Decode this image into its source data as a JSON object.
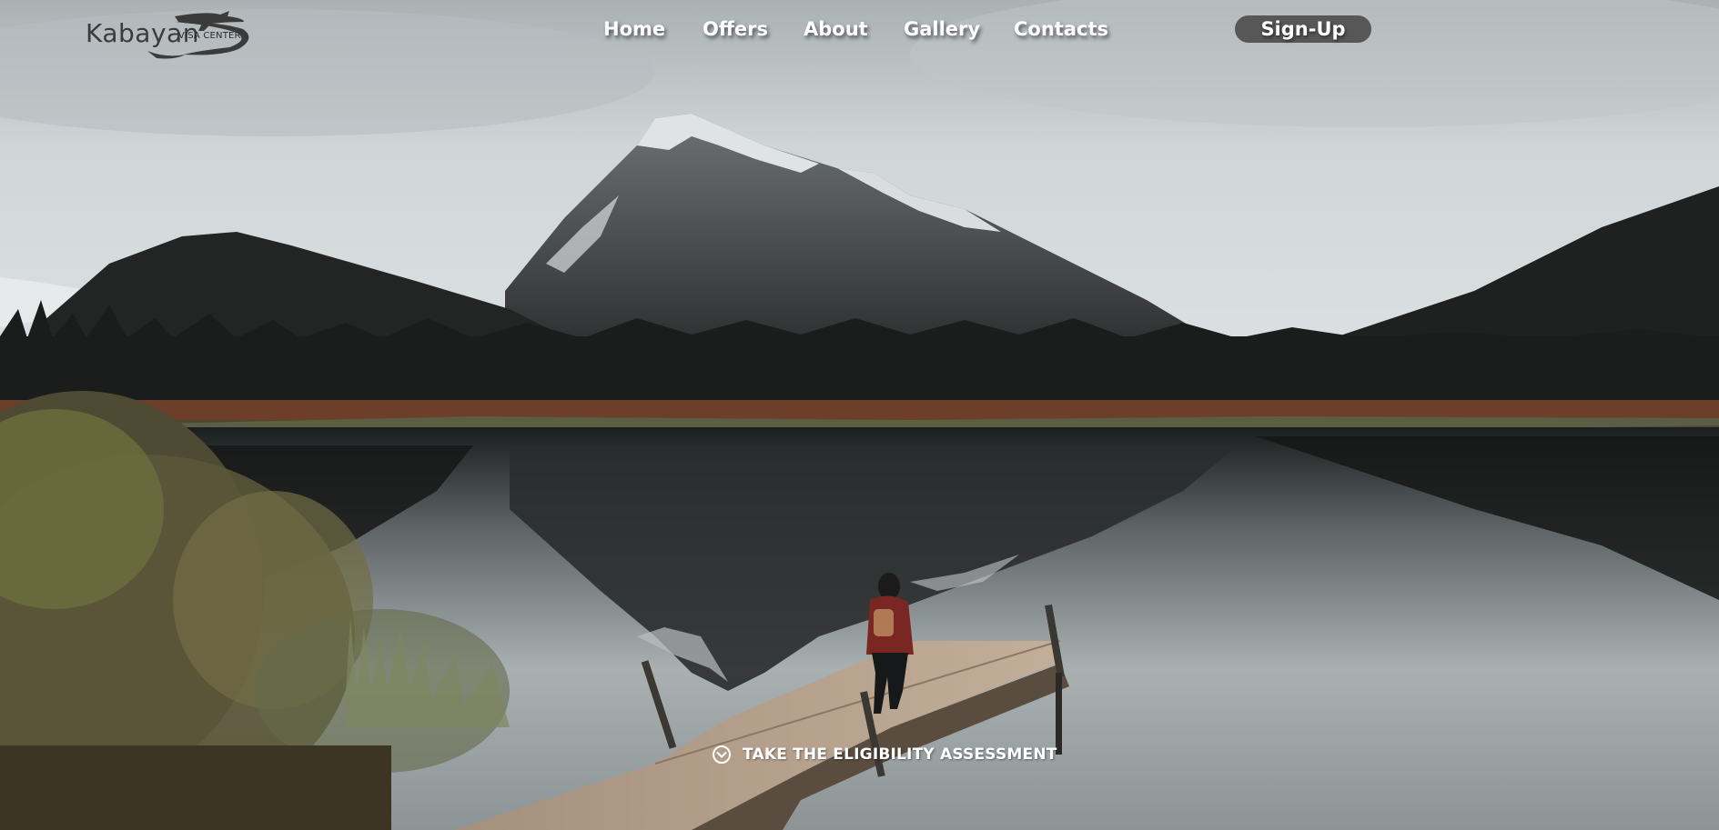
{
  "brand": {
    "name": "Kabayan",
    "subtitle": "VISA CENTER",
    "logo_color": "#3b3b3b"
  },
  "nav": {
    "items": [
      {
        "label": "Home"
      },
      {
        "label": "Offers"
      },
      {
        "label": "About"
      },
      {
        "label": "Gallery"
      },
      {
        "label": "Contacts"
      }
    ],
    "signup_label": "Sign-Up",
    "signup_bg": "#575757"
  },
  "hero": {
    "background": "mountain-lake-dock-photo",
    "cta_label": "TAKE THE ELIGIBILITY ASSESSMENT",
    "cta_icon": "chevron-down-circle-icon"
  }
}
